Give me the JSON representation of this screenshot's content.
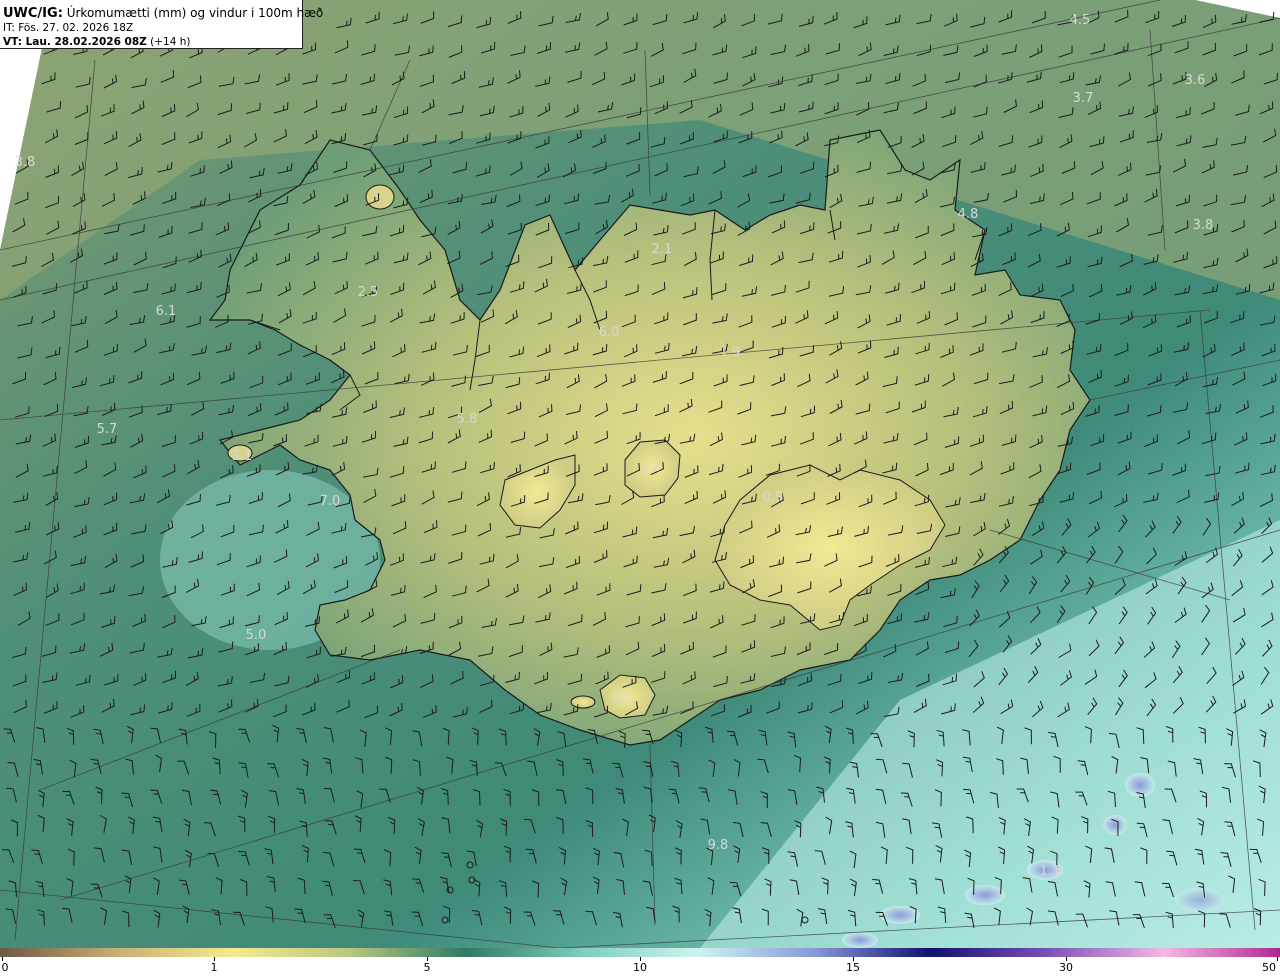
{
  "header": {
    "product": "UWC/IG:",
    "field": "Úrkomumætti (mm) og vindur i 100m hæð",
    "init_time": "IT: Fös. 27. 02. 2026 18Z",
    "valid_label": "VT: Lau. 28.02.2026 08Z",
    "lead": "(+14 h)"
  },
  "map_values": [
    {
      "id": "v-45",
      "text": "4.5"
    },
    {
      "id": "v-36",
      "text": "3.6"
    },
    {
      "id": "v-37",
      "text": "3.7"
    },
    {
      "id": "v-38w",
      "text": "3.8"
    },
    {
      "id": "v-48",
      "text": "4.8"
    },
    {
      "id": "v-38e",
      "text": "3.8"
    },
    {
      "id": "v-21",
      "text": "2.1"
    },
    {
      "id": "v-25",
      "text": "2.5"
    },
    {
      "id": "v-61",
      "text": "6.1"
    },
    {
      "id": "v-60",
      "text": "6.0"
    },
    {
      "id": "v-19",
      "text": "1.9"
    },
    {
      "id": "v-58",
      "text": "5.8"
    },
    {
      "id": "v-57",
      "text": "5.7"
    },
    {
      "id": "v-31",
      "text": "3.1"
    },
    {
      "id": "v-12",
      "text": "1.2"
    },
    {
      "id": "v-09",
      "text": "0.9"
    },
    {
      "id": "v-70",
      "text": "7.0"
    },
    {
      "id": "v-50",
      "text": "5.0"
    },
    {
      "id": "v-30",
      "text": "3.0"
    },
    {
      "id": "v-98",
      "text": "9.8"
    },
    {
      "id": "v-11",
      "text": "1.1"
    }
  ],
  "colorbar": {
    "ticks": [
      "0",
      "1",
      "5",
      "10",
      "15",
      "30",
      "50"
    ],
    "colors": [
      "#6b5a45",
      "#c9ae74",
      "#f4ea8c",
      "#b8c77f",
      "#2f7a66",
      "#7fcdbd",
      "#cdf3ee",
      "#8899d9",
      "#101070",
      "#7a4fb8",
      "#f2b8e6",
      "#b0288f"
    ]
  },
  "legend_colors": {
    "land": "#a7b673",
    "highland": "#e8e089",
    "sea": "#3f8b78",
    "sea_light": "#a9e4da",
    "coast": "#1a1a1a"
  }
}
